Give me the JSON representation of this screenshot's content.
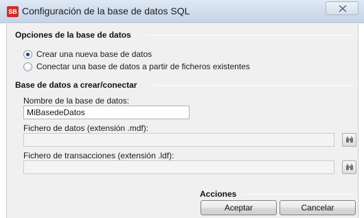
{
  "window": {
    "icon_text": "SB",
    "title": "Configuración de la base de datos SQL",
    "close_glyph": "X"
  },
  "options_group": {
    "title": "Opciones de la base de datos",
    "radios": [
      {
        "label": "Crear una nueva base de datos",
        "checked": true
      },
      {
        "label": "Conectar una base de datos a partir de ficheros existentes",
        "checked": false
      }
    ]
  },
  "database_group": {
    "title": "Base de datos a crear/conectar",
    "name_label": "Nombre de la base de datos:",
    "name_value": "MiBasedeDatos",
    "data_file_label": "Fichero de datos (extensión .mdf):",
    "data_file_value": "",
    "log_file_label": "Fichero de transacciones (extensión .ldf):",
    "log_file_value": ""
  },
  "actions_group": {
    "title": "Acciones",
    "accept_label": "Aceptar",
    "cancel_label": "Cancelar"
  },
  "icons": {
    "app": "sb-app-icon",
    "close": "close-icon",
    "browse": "binoculars-icon"
  }
}
